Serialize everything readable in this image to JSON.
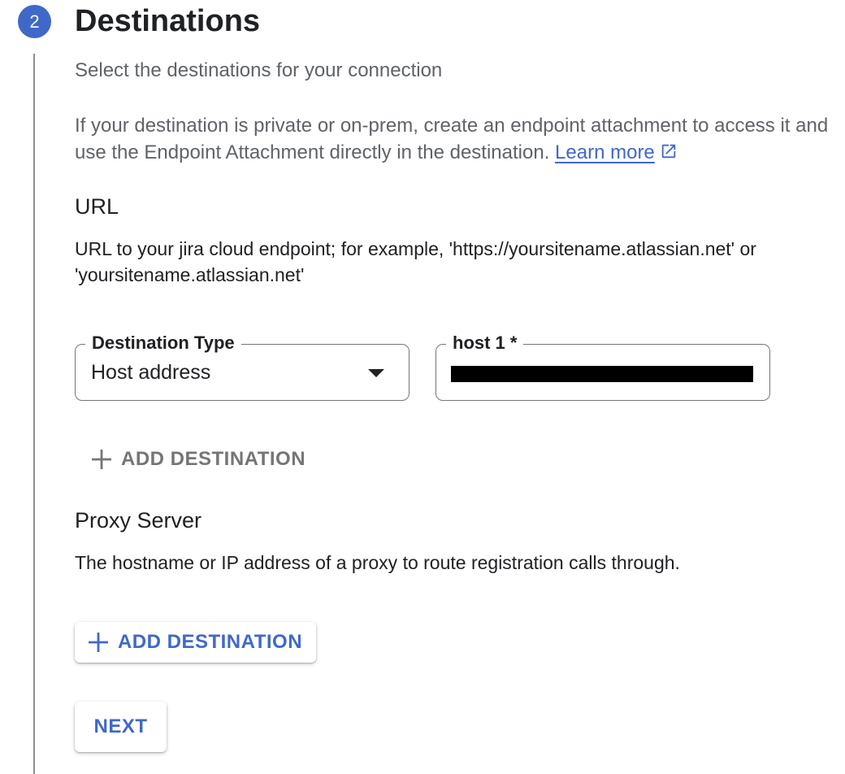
{
  "step": {
    "number": "2",
    "title": "Destinations",
    "subtitle": "Select the destinations for your connection"
  },
  "info": {
    "text": "If your destination is private or on-prem, create an endpoint attachment to access it and use the Endpoint Attachment directly in the destination.",
    "link_label": "Learn more",
    "link_icon": "open-in-new-icon"
  },
  "url_section": {
    "heading": "URL",
    "description": "URL to your jira cloud endpoint; for example, 'https://yoursitename.atlassian.net' or 'yoursitename.atlassian.net'",
    "destination_type": {
      "label": "Destination Type",
      "value": "Host address"
    },
    "host": {
      "label": "host 1 *"
    },
    "add_button_label": "ADD DESTINATION"
  },
  "proxy_section": {
    "heading": "Proxy Server",
    "description": "The hostname or IP address of a proxy to route registration calls through.",
    "add_button_label": "ADD DESTINATION"
  },
  "next_label": "NEXT",
  "colors": {
    "accent": "#3f68c9",
    "disabled": "#757575"
  }
}
